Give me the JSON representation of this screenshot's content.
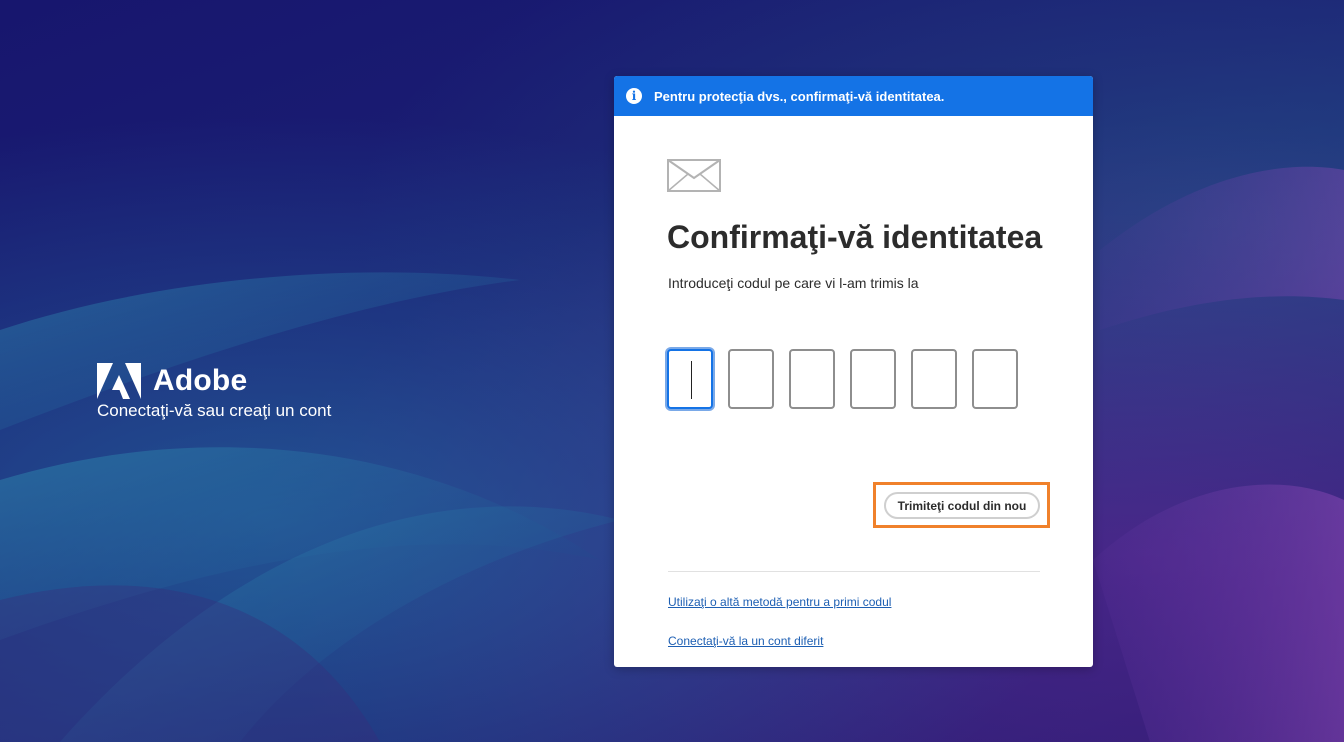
{
  "brand": {
    "name": "Adobe",
    "tagline": "Conectaţi-vă sau creaţi un cont"
  },
  "banner": {
    "icon": "info-icon",
    "text": "Pentru protecţia dvs., confirmaţi-vă identitatea."
  },
  "card": {
    "icon": "envelope-icon",
    "title": "Confirmaţi-vă identitatea",
    "subtitle": "Introduceţi codul pe care vi l-am trimis la",
    "code_digits": [
      "",
      "",
      "",
      "",
      "",
      ""
    ],
    "resend_label": "Trimiteţi codul din nou",
    "links": {
      "other_method": "Utilizaţi o altă metodă pentru a primi codul",
      "different_account": "Conectaţi-vă la un cont diferit"
    }
  },
  "colors": {
    "banner": "#1473e6",
    "highlight": "#f0812b",
    "link": "#1d5fb3"
  }
}
